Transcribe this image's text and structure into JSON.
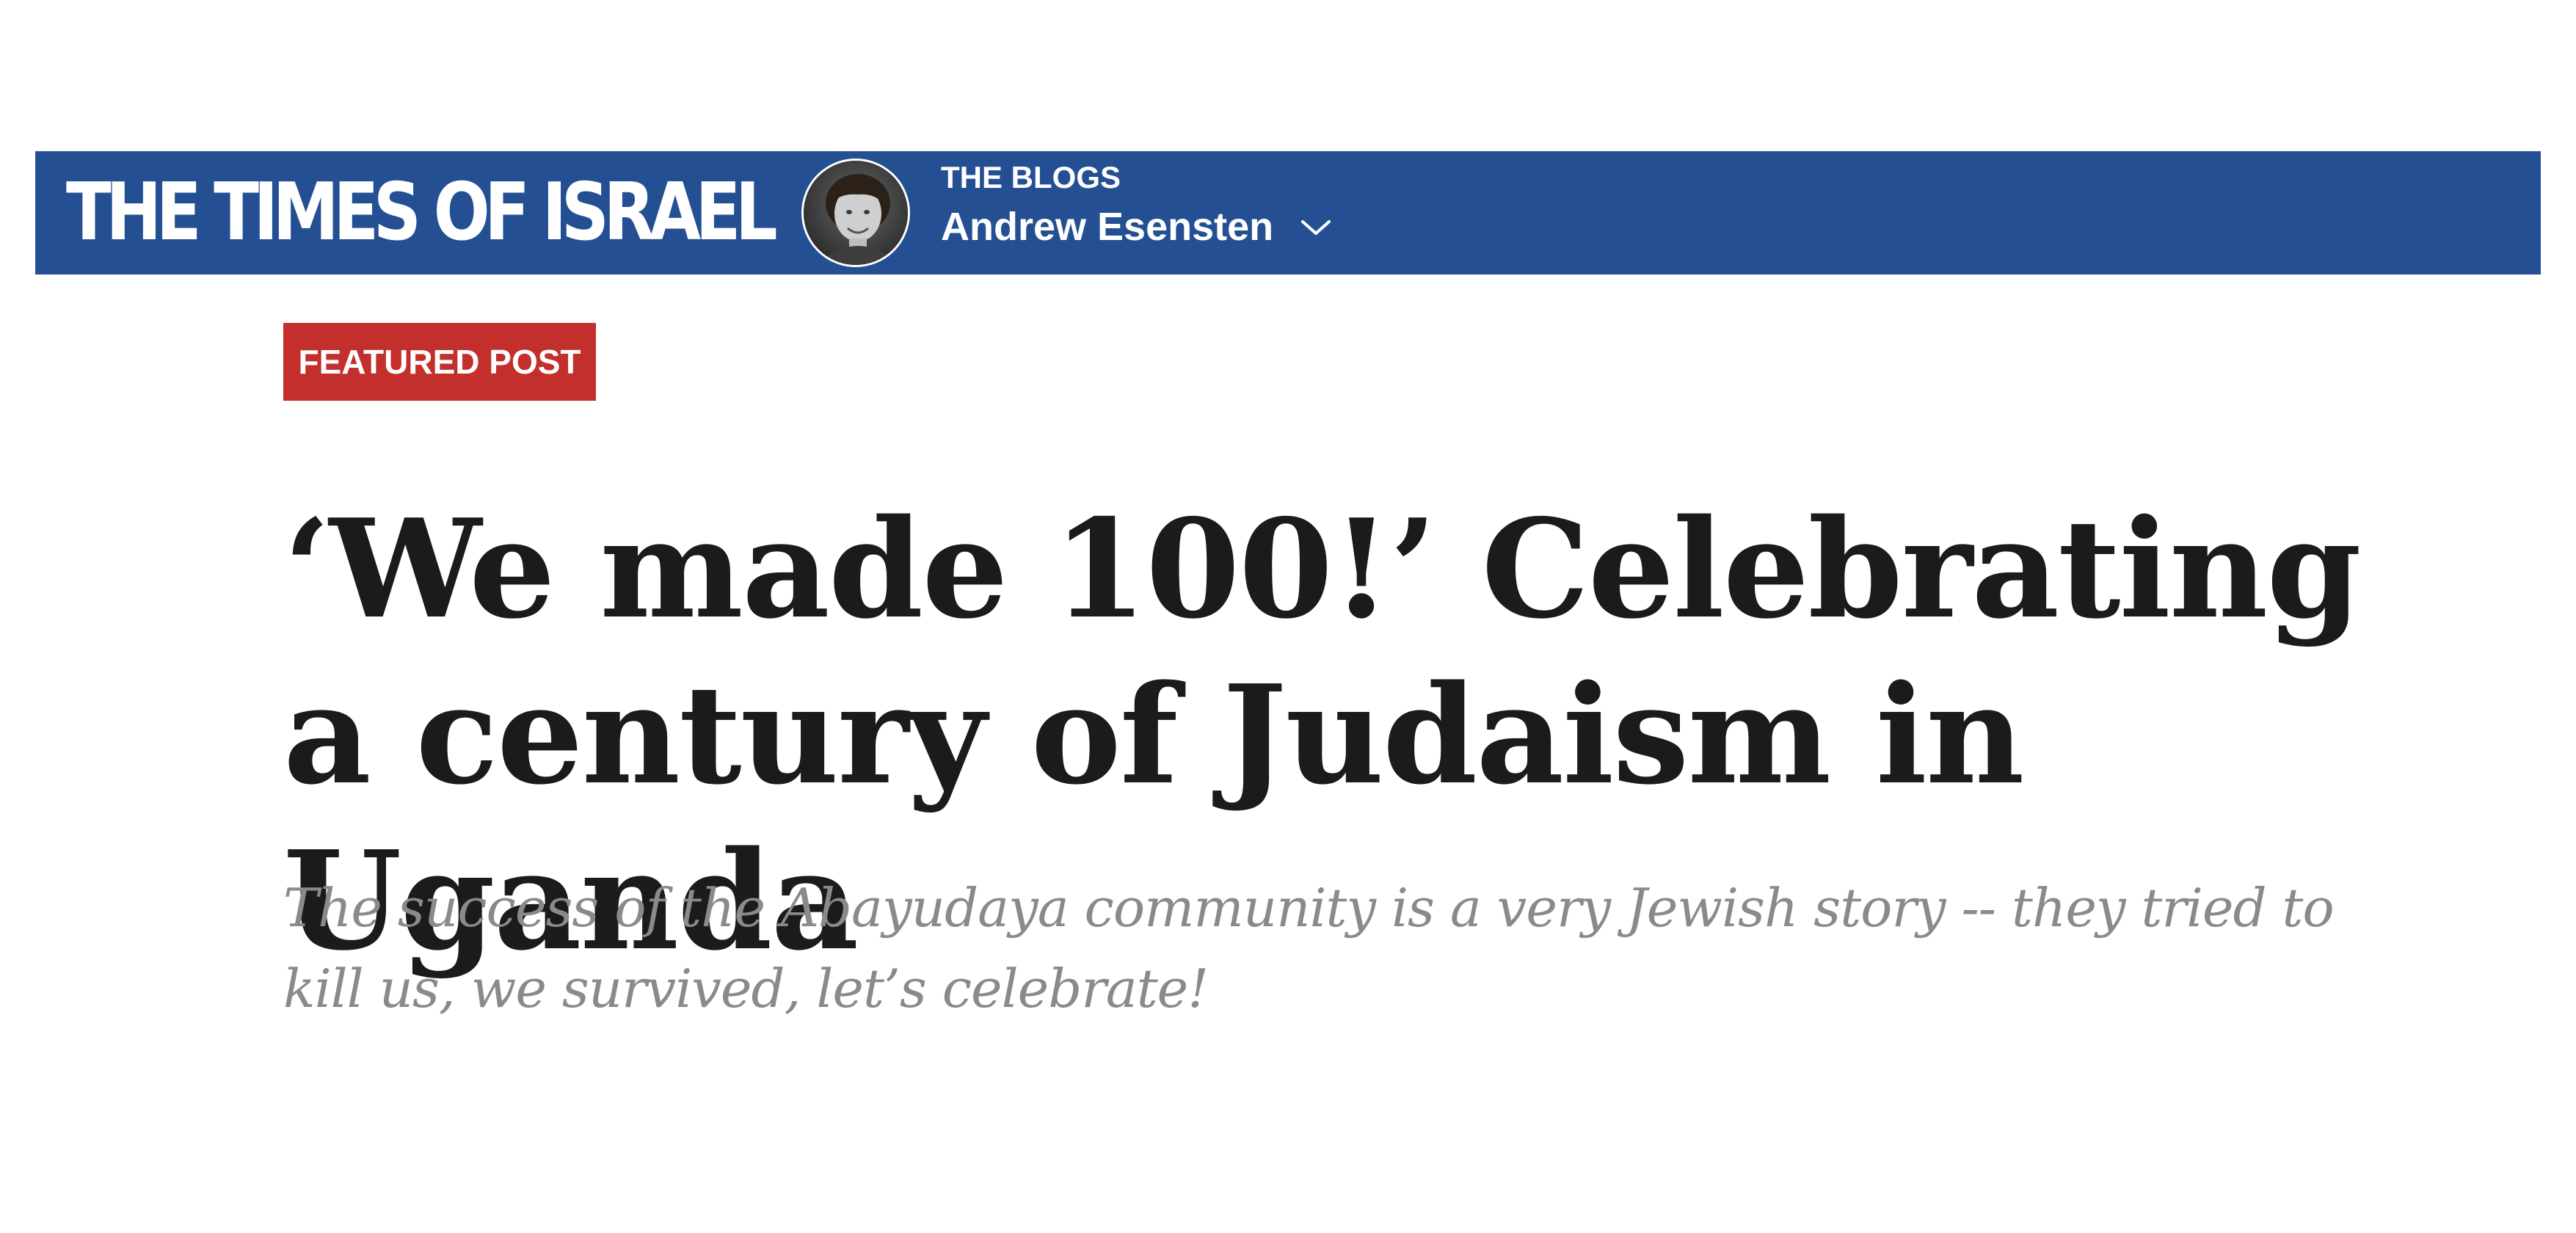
{
  "header": {
    "site_name": "THE TIMES OF ISRAEL",
    "section_label": "THE BLOGS",
    "author_name": "Andrew Esensten",
    "colors": {
      "brand_blue": "#245093",
      "text_on_brand": "#ffffff"
    },
    "icons": {
      "author_menu": "chevron-down-icon",
      "author_photo": "avatar"
    }
  },
  "article": {
    "badge": "FEATURED POST",
    "badge_color": "#c22f2c",
    "title": "‘We made 100!’ Celebrating a century of Judaism in Uganda",
    "subtitle": "The success of the Abayudaya community is a very Jewish story -- they tried to kill us, we survived, let’s celebrate!"
  }
}
